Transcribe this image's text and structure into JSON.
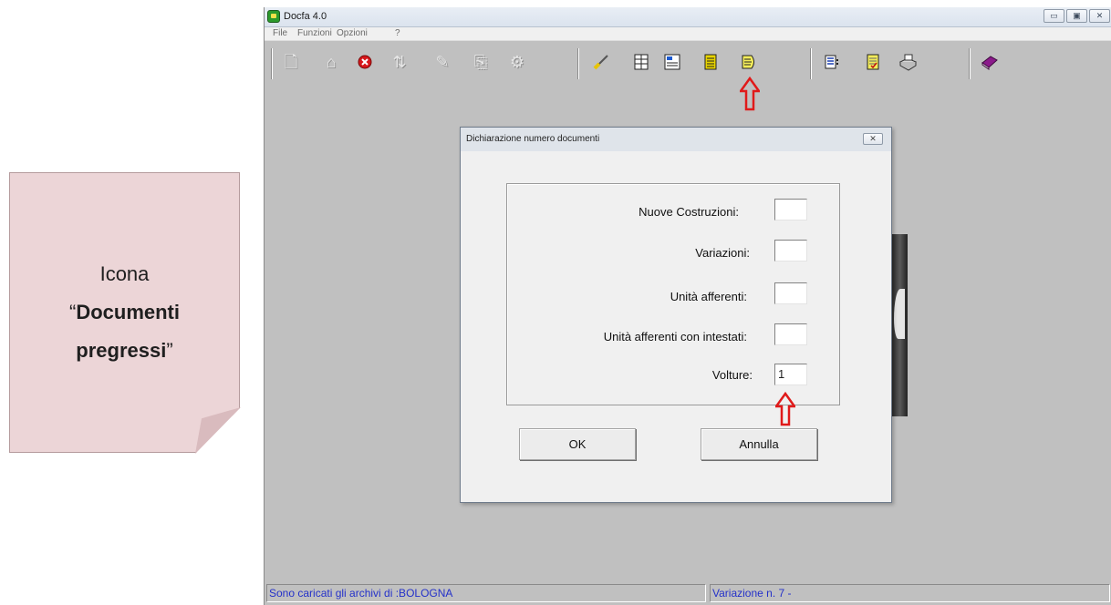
{
  "callout": {
    "line1": "Icona",
    "quote_open": "“",
    "bold1": "Documenti",
    "bold2": "pregressi",
    "quote_close": "”"
  },
  "window": {
    "title": "Docfa 4.0",
    "controls": [
      "minimize-icon",
      "maximize-icon",
      "close-icon"
    ]
  },
  "menu": {
    "items": [
      "File",
      "Funzioni",
      "Opzioni",
      "?"
    ]
  },
  "toolbar": {
    "group1": [
      "new-document-icon",
      "open-icon",
      "delete-icon",
      "transfer-icon",
      "edit-transfer-icon",
      "copy-icon",
      "settings-icon"
    ],
    "group2": [
      "brush-icon",
      "grid-form-icon",
      "card-form-icon",
      "list-icon",
      "documenti-pregressi-icon"
    ],
    "group3": [
      "report-icon",
      "notepad-icon",
      "printer-icon"
    ],
    "group4": [
      "help-book-icon"
    ]
  },
  "dialog": {
    "title": "Dichiarazione numero documenti",
    "fields": [
      {
        "label": "Nuove Costruzioni:",
        "value": ""
      },
      {
        "label": "Variazioni:",
        "value": ""
      },
      {
        "label": "Unità afferenti:",
        "value": ""
      },
      {
        "label": "Unità afferenti con intestati:",
        "value": ""
      },
      {
        "label": "Volture:",
        "value": "1"
      }
    ],
    "ok_label": "OK",
    "cancel_label": "Annulla"
  },
  "status": {
    "left": "Sono caricati gli archivi di :BOLOGNA",
    "right": "Variazione n.   7 -"
  },
  "colors": {
    "highlight_arrow": "#e01a1a",
    "status_text": "#2431c9",
    "callout_bg": "#ecd5d7"
  }
}
